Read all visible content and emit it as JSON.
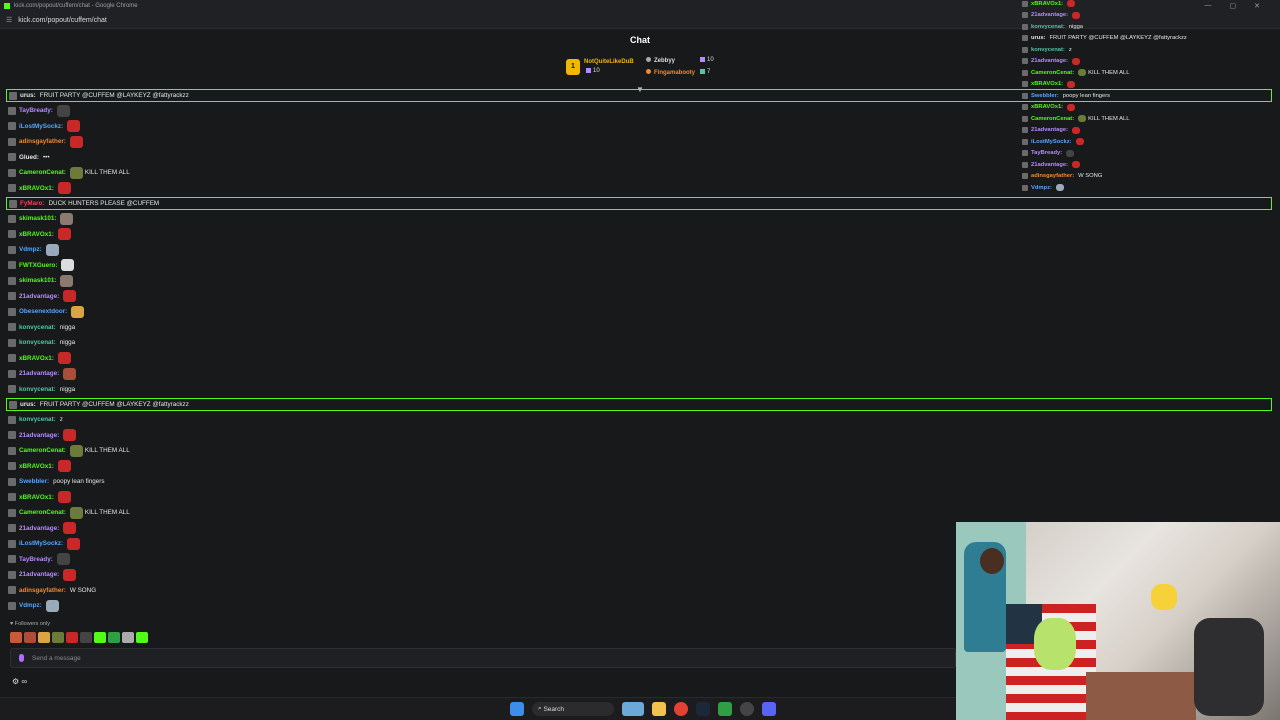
{
  "browser": {
    "window_title": "kick.com/popout/cuffem/chat - Google Chrome",
    "url": "kick.com/popout/cuffem/chat"
  },
  "chat": {
    "header": "Chat",
    "leaderboard": [
      {
        "name": "NotQuiteLikeDuB",
        "count": "10",
        "color": "#f2b705"
      },
      {
        "name": "Zebbyy",
        "count": "10",
        "color": "#dddddd"
      },
      {
        "name": "Fingamabooty",
        "count": "7",
        "color": "#f28a2e"
      }
    ],
    "leaderboard_rank": "1",
    "messages": [
      {
        "user": "urus",
        "color": "#e6e6e6",
        "text": "FRUIT PARTY @CUFFEM @LAYKEYZ @fattyrackzz",
        "hl": true
      },
      {
        "user": "TayBready",
        "color": "#b48cff",
        "text": "",
        "emote": "#444444"
      },
      {
        "user": "iLostMySockz",
        "color": "#58a6ff",
        "text": "",
        "emote": "#c82828"
      },
      {
        "user": "adinsgayfather",
        "color": "#f28a2e",
        "text": "",
        "emote": "#c82828"
      },
      {
        "user": "Glued",
        "color": "#e6e6e6",
        "text": "•••",
        "emote": ""
      },
      {
        "user": "CameronCenat",
        "color": "#53fc18",
        "text": "KILL THEM ALL",
        "emote": "#6b7b3a"
      },
      {
        "user": "xBRAVOx1",
        "color": "#53fc18",
        "text": "",
        "emote": "#c82828"
      },
      {
        "user": "FyMaro",
        "color": "#ff3b5c",
        "text": "DUCK HUNTERS PLEASE @CUFFEM",
        "hl": true
      },
      {
        "user": "skimask101",
        "color": "#53fc18",
        "text": "",
        "emote": "#8a7a70"
      },
      {
        "user": "xBRAVOx1",
        "color": "#53fc18",
        "text": "",
        "emote": "#c82828"
      },
      {
        "user": "Vdmpz",
        "color": "#58a6ff",
        "text": "",
        "emote": "#9ab"
      },
      {
        "user": "FWTXGuero",
        "color": "#53fc18",
        "text": "",
        "emote": "#dddddd"
      },
      {
        "user": "skimask101",
        "color": "#53fc18",
        "text": "",
        "emote": "#8a7a70"
      },
      {
        "user": "21advantage",
        "color": "#b48cff",
        "text": "",
        "emote": "#c82828"
      },
      {
        "user": "Obesenextdoor",
        "color": "#58a6ff",
        "text": "",
        "emote": "#d9a441"
      },
      {
        "user": "konvycenat",
        "color": "#53c6a8",
        "text": "nigga",
        "emote": ""
      },
      {
        "user": "konvycenat",
        "color": "#53c6a8",
        "text": "nigga",
        "emote": ""
      },
      {
        "user": "xBRAVOx1",
        "color": "#53fc18",
        "text": "",
        "emote": "#c82828"
      },
      {
        "user": "21advantage",
        "color": "#b48cff",
        "text": "",
        "emote": "#a84e3a"
      },
      {
        "user": "konvycenat",
        "color": "#53c6a8",
        "text": "nigga",
        "emote": ""
      },
      {
        "user": "urus",
        "color": "#e6e6e6",
        "text": "FRUIT PARTY @CUFFEM @LAYKEYZ @fattyrackzz",
        "hl": true
      },
      {
        "user": "konvycenat",
        "color": "#53c6a8",
        "text": "z",
        "emote": ""
      },
      {
        "user": "21advantage",
        "color": "#b48cff",
        "text": "",
        "emote": "#c82828"
      },
      {
        "user": "CameronCenat",
        "color": "#53fc18",
        "text": "KILL THEM ALL",
        "emote": "#6b7b3a"
      },
      {
        "user": "xBRAVOx1",
        "color": "#53fc18",
        "text": "",
        "emote": "#c82828"
      },
      {
        "user": "Swebbler",
        "color": "#58a6ff",
        "text": "poopy lean fingers",
        "emote": ""
      },
      {
        "user": "xBRAVOx1",
        "color": "#53fc18",
        "text": "",
        "emote": "#c82828"
      },
      {
        "user": "CameronCenat",
        "color": "#53fc18",
        "text": "KILL THEM ALL",
        "emote": "#6b7b3a"
      },
      {
        "user": "21advantage",
        "color": "#b48cff",
        "text": "",
        "emote": "#c82828"
      },
      {
        "user": "iLostMySockz",
        "color": "#58a6ff",
        "text": "",
        "emote": "#c82828"
      },
      {
        "user": "TayBready",
        "color": "#b48cff",
        "text": "",
        "emote": "#444444"
      },
      {
        "user": "21advantage",
        "color": "#b48cff",
        "text": "",
        "emote": "#c82828"
      },
      {
        "user": "adinsgayfather",
        "color": "#f28a2e",
        "text": "W SONG",
        "emote": ""
      },
      {
        "user": "Vdmpz",
        "color": "#58a6ff",
        "text": "",
        "emote": "#9ab"
      }
    ],
    "followers_only": "Followers only",
    "input_placeholder": "Send a message",
    "bottom_symbol": "∞"
  },
  "overlay": [
    {
      "user": "xBRAVOx1",
      "color": "#53fc18",
      "text": "",
      "emote": "#c82828"
    },
    {
      "user": "21advantage",
      "color": "#b48cff",
      "text": "",
      "emote": "#c82828"
    },
    {
      "user": "konvycenat",
      "color": "#53c6a8",
      "text": "nigga",
      "emote": ""
    },
    {
      "user": "urus",
      "color": "#e6e6e6",
      "text": "FRUIT PARTY @CUFFEM @LAYKEYZ @fattyrackzz",
      "emote": ""
    },
    {
      "user": "konvycenat",
      "color": "#53c6a8",
      "text": "z",
      "emote": ""
    },
    {
      "user": "21advantage",
      "color": "#b48cff",
      "text": "",
      "emote": "#c82828"
    },
    {
      "user": "CameronCenat",
      "color": "#53fc18",
      "text": "KILL THEM ALL",
      "emote": "#6b7b3a"
    },
    {
      "user": "xBRAVOx1",
      "color": "#53fc18",
      "text": "",
      "emote": "#c82828"
    },
    {
      "user": "Swebbler",
      "color": "#58a6ff",
      "text": "poopy lean fingers",
      "emote": ""
    },
    {
      "user": "xBRAVOx1",
      "color": "#53fc18",
      "text": "",
      "emote": "#c82828"
    },
    {
      "user": "CameronCenat",
      "color": "#53fc18",
      "text": "KILL THEM ALL",
      "emote": "#6b7b3a"
    },
    {
      "user": "21advantage",
      "color": "#b48cff",
      "text": "",
      "emote": "#c82828"
    },
    {
      "user": "iLostMySockz",
      "color": "#58a6ff",
      "text": "",
      "emote": "#c82828"
    },
    {
      "user": "TayBready",
      "color": "#b48cff",
      "text": "",
      "emote": "#444444"
    },
    {
      "user": "21advantage",
      "color": "#b48cff",
      "text": "",
      "emote": "#c82828"
    },
    {
      "user": "adinsgayfather",
      "color": "#f28a2e",
      "text": "W SONG",
      "emote": ""
    },
    {
      "user": "Vdmpz",
      "color": "#58a6ff",
      "text": "",
      "emote": "#9ab"
    }
  ],
  "taskbar": {
    "search_label": "Search",
    "icons": [
      "windows-start-icon",
      "search-icon",
      "widget-icon",
      "file-explorer-icon",
      "chrome-icon",
      "steam-icon",
      "app-icon",
      "obs-icon",
      "discord-icon"
    ]
  },
  "emote_bar_colors": [
    "#c85a3a",
    "#b04a3a",
    "#d9a441",
    "#6b7b3a",
    "#c82828",
    "#444444",
    "#53fc18",
    "#2ea043",
    "#aaaaaa",
    "#53fc18"
  ]
}
